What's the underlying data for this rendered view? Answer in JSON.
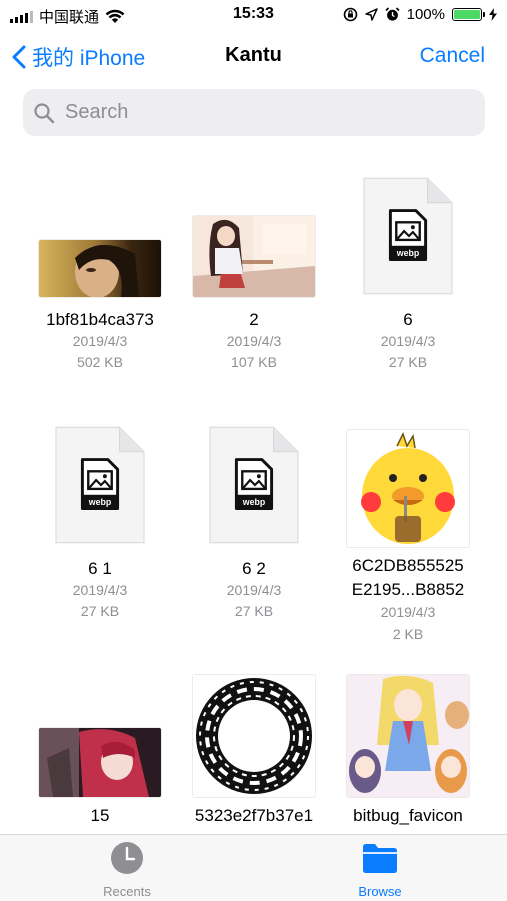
{
  "status_bar": {
    "carrier": "中国联通",
    "time": "15:33",
    "battery": "100%",
    "battery_level": 1.0
  },
  "nav": {
    "back_label": "我的 iPhone",
    "title": "Kantu",
    "cancel_label": "Cancel"
  },
  "search": {
    "placeholder": "Search"
  },
  "files": [
    {
      "name": "1bf81b4ca373",
      "date": "2019/4/3",
      "size": "502 KB",
      "kind": "photo"
    },
    {
      "name": "2",
      "date": "2019/4/3",
      "size": "107 KB",
      "kind": "anime-classroom"
    },
    {
      "name": "6",
      "date": "2019/4/3",
      "size": "27 KB",
      "kind": "webp-doc"
    },
    {
      "name": "6 1",
      "date": "2019/4/3",
      "size": "27 KB",
      "kind": "webp-doc"
    },
    {
      "name": "6 2",
      "date": "2019/4/3",
      "size": "27 KB",
      "kind": "webp-doc"
    },
    {
      "name_line1": "6C2DB855525",
      "name_line2": "E2195...B8852",
      "date": "2019/4/3",
      "size": "2 KB",
      "kind": "duck-sticker"
    },
    {
      "name": "15",
      "kind": "anime-girl"
    },
    {
      "name": "5323e2f7b37e1",
      "kind": "ring-pattern"
    },
    {
      "name": "bitbug_favicon",
      "kind": "anime-group"
    }
  ],
  "doc_badge": "webp",
  "tabs": [
    {
      "label": "Recents",
      "icon": "clock-icon",
      "active": false
    },
    {
      "label": "Browse",
      "icon": "folder-icon",
      "active": true
    }
  ],
  "colors": {
    "accent": "#0a7cff",
    "inactive": "#8e8e93"
  }
}
